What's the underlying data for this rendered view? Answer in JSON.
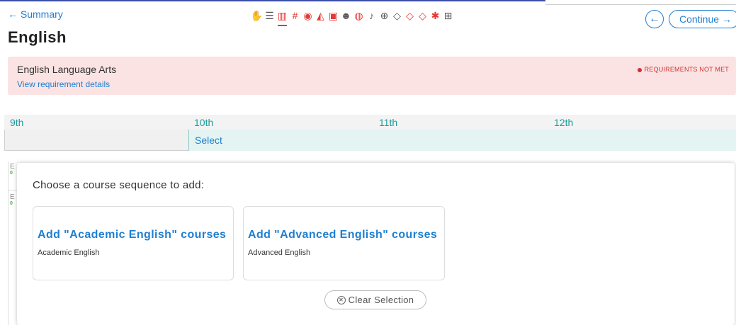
{
  "header": {
    "back_label": "← Summary",
    "title": "English",
    "prev_icon": "arrow-left-icon",
    "continue_label": "Continue →"
  },
  "subject_icons": [
    {
      "name": "hand-icon",
      "glyph": "✋",
      "color": "#555555"
    },
    {
      "name": "standard-icon",
      "glyph": "☰",
      "color": "#555555"
    },
    {
      "name": "books-icon",
      "glyph": "▥",
      "color": "#e53935",
      "active": true
    },
    {
      "name": "math-grid-icon",
      "glyph": "#",
      "color": "#e53935"
    },
    {
      "name": "globe-icon",
      "glyph": "◉",
      "color": "#e53935"
    },
    {
      "name": "science-icon",
      "glyph": "◭",
      "color": "#e53935"
    },
    {
      "name": "language-icon",
      "glyph": "▣",
      "color": "#e53935"
    },
    {
      "name": "pe-icon",
      "glyph": "☻",
      "color": "#555555"
    },
    {
      "name": "arts-icon",
      "glyph": "◍",
      "color": "#e53935"
    },
    {
      "name": "microphone-icon",
      "glyph": "♪",
      "color": "#555555"
    },
    {
      "name": "health-icon",
      "glyph": "⊕",
      "color": "#555555"
    },
    {
      "name": "diamond-outline-icon",
      "glyph": "◇",
      "color": "#555555"
    },
    {
      "name": "diamond-red-icon-1",
      "glyph": "◇",
      "color": "#e53935"
    },
    {
      "name": "diamond-red-icon-2",
      "glyph": "◇",
      "color": "#e53935"
    },
    {
      "name": "asterisk-icon",
      "glyph": "✱",
      "color": "#e53935"
    },
    {
      "name": "table-icon",
      "glyph": "⊞",
      "color": "#555555"
    }
  ],
  "requirement": {
    "name": "English Language Arts",
    "details_link": "View requirement details",
    "status": "REQUIREMENTS NOT MET",
    "status_color": "#d32f2f"
  },
  "grades": [
    "9th",
    "10th",
    "11th",
    "12th"
  ],
  "select_label": "Select",
  "modal": {
    "heading": "Choose a course sequence to add:",
    "options": [
      {
        "title": "Add \"Academic English\" courses",
        "subtitle": "Academic English"
      },
      {
        "title": "Add \"Advanced English\" courses",
        "subtitle": "Advanced English"
      }
    ],
    "clear_label": "Clear Selection"
  },
  "colors": {
    "accent": "#1f7fd1",
    "grade_text": "#1a9c9c",
    "banner_bg": "#fbe3e3",
    "selected_cell_bg": "#e3f4f2"
  }
}
